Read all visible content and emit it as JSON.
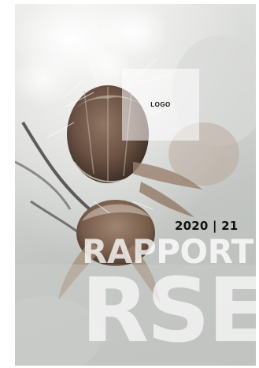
{
  "cover": {
    "logo_label": "LOGO",
    "year": "2020 | 21",
    "title_line1": "RAPPORT",
    "title_line2": "RSE"
  }
}
